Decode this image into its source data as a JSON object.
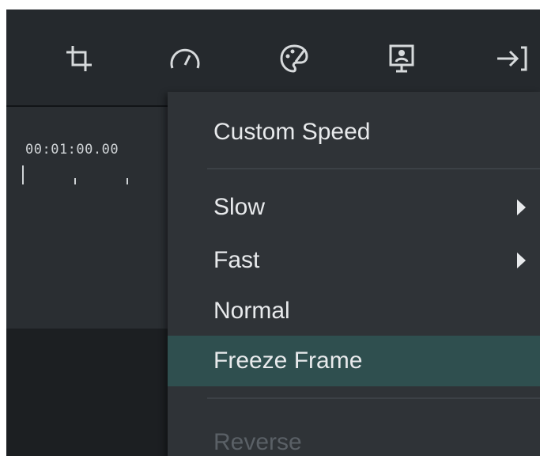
{
  "toolbar": {
    "tools": [
      {
        "icon": "crop-icon"
      },
      {
        "icon": "speed-gauge-icon"
      },
      {
        "icon": "color-palette-icon"
      },
      {
        "icon": "green-screen-icon"
      },
      {
        "icon": "export-arrow-icon"
      }
    ]
  },
  "timeline": {
    "timecode": "00:01:00.00"
  },
  "speed_menu": {
    "custom_speed": "Custom Speed",
    "slow": "Slow",
    "fast": "Fast",
    "normal": "Normal",
    "freeze_frame": "Freeze Frame",
    "reverse": "Reverse"
  },
  "colors": {
    "background": "#1e2226",
    "menu": "#2f3337",
    "highlight": "#2f4f4f",
    "text": "#e8eaec",
    "disabled_text": "#5a6066"
  }
}
